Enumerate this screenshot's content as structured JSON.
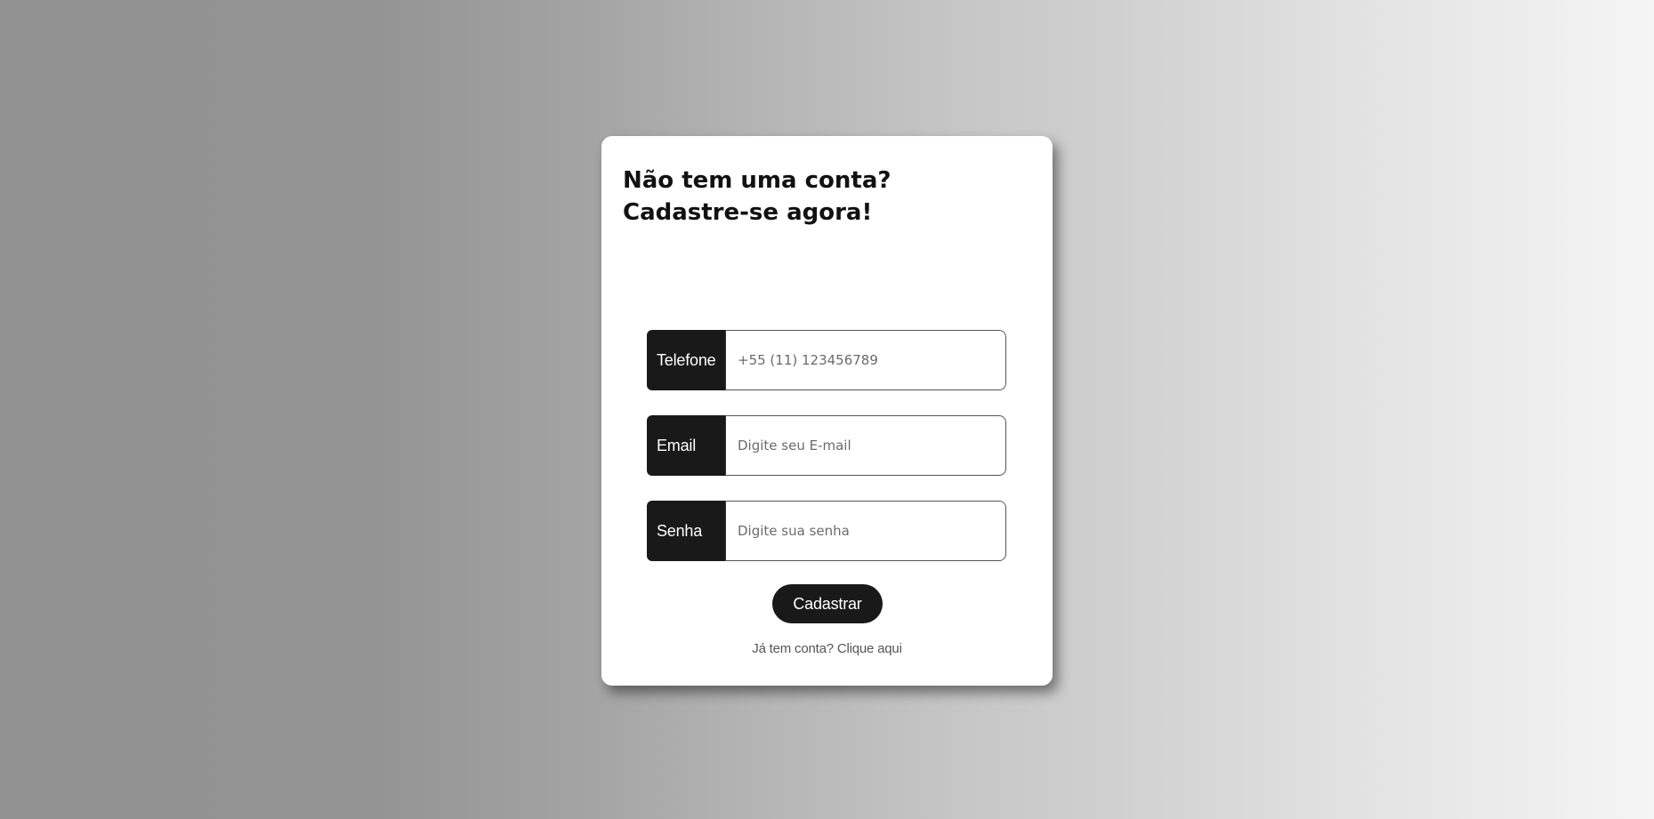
{
  "signup": {
    "title": "Não tem uma conta? Cadastre-se agora!",
    "fields": [
      {
        "label": "Telefone",
        "placeholder": "+55 (11) 123456789",
        "value": ""
      },
      {
        "label": "Email",
        "placeholder": "Digite seu E-mail",
        "value": ""
      },
      {
        "label": "Senha",
        "placeholder": "Digite sua senha",
        "value": ""
      }
    ],
    "submit_label": "Cadastrar",
    "login_link": "Já tem conta? Clique aqui"
  },
  "colors": {
    "card_background": "#ffffff",
    "label_background": "#191919",
    "button_background": "#191919",
    "link_text": "#555555"
  }
}
